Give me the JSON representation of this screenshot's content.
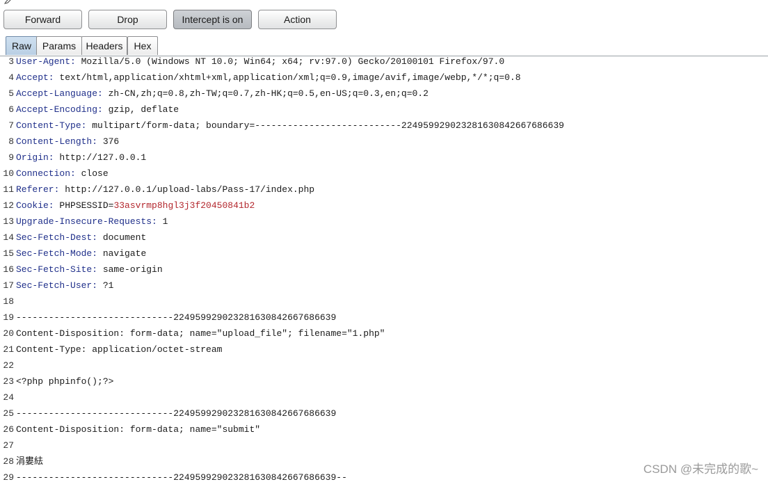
{
  "toolbar": {
    "forward": "Forward",
    "drop": "Drop",
    "intercept": "Intercept is on",
    "action": "Action"
  },
  "tabs": [
    "Raw",
    "Params",
    "Headers",
    "Hex"
  ],
  "active_tab": "Raw",
  "request_lines": [
    {
      "n": "3",
      "key": "User-Agent:",
      "val": " Mozilla/5.0 (Windows NT 10.0; Win64; x64; rv:97.0) Gecko/20100101 Firefox/97.0"
    },
    {
      "n": "4",
      "key": "Accept:",
      "val": " text/html,application/xhtml+xml,application/xml;q=0.9,image/avif,image/webp,*/*;q=0.8"
    },
    {
      "n": "5",
      "key": "Accept-Language:",
      "val": " zh-CN,zh;q=0.8,zh-TW;q=0.7,zh-HK;q=0.5,en-US;q=0.3,en;q=0.2"
    },
    {
      "n": "6",
      "key": "Accept-Encoding:",
      "val": " gzip, deflate"
    },
    {
      "n": "7",
      "key": "Content-Type:",
      "val": " multipart/form-data; boundary=---------------------------224959929023281630842667686639"
    },
    {
      "n": "8",
      "key": "Content-Length:",
      "val": " 376"
    },
    {
      "n": "9",
      "key": "Origin:",
      "val": " http://127.0.0.1"
    },
    {
      "n": "10",
      "key": "Connection:",
      "val": " close"
    },
    {
      "n": "11",
      "key": "Referer:",
      "val": " http://127.0.0.1/upload-labs/Pass-17/index.php"
    },
    {
      "n": "12",
      "key": "Cookie:",
      "val": " PHPSESSID=",
      "red": "33asvrmp8hgl3j3f20450841b2"
    },
    {
      "n": "13",
      "key": "Upgrade-Insecure-Requests:",
      "val": " 1"
    },
    {
      "n": "14",
      "key": "Sec-Fetch-Dest:",
      "val": " document"
    },
    {
      "n": "15",
      "key": "Sec-Fetch-Mode:",
      "val": " navigate"
    },
    {
      "n": "16",
      "key": "Sec-Fetch-Site:",
      "val": " same-origin"
    },
    {
      "n": "17",
      "key": "Sec-Fetch-User:",
      "val": " ?1"
    },
    {
      "n": "18",
      "key": "",
      "val": ""
    },
    {
      "n": "19",
      "key": "",
      "val": "-----------------------------224959929023281630842667686639"
    },
    {
      "n": "20",
      "key": "",
      "val": "Content-Disposition: form-data; name=\"upload_file\"; filename=\"1.php\""
    },
    {
      "n": "21",
      "key": "",
      "val": "Content-Type: application/octet-stream"
    },
    {
      "n": "22",
      "key": "",
      "val": ""
    },
    {
      "n": "23",
      "key": "",
      "val": "<?php phpinfo();?>"
    },
    {
      "n": "24",
      "key": "",
      "val": ""
    },
    {
      "n": "25",
      "key": "",
      "val": "-----------------------------224959929023281630842667686639"
    },
    {
      "n": "26",
      "key": "",
      "val": "Content-Disposition: form-data; name=\"submit\""
    },
    {
      "n": "27",
      "key": "",
      "val": ""
    },
    {
      "n": "28",
      "key": "",
      "val": "涓婁紶"
    },
    {
      "n": "29",
      "key": "",
      "val": "-----------------------------224959929023281630842667686639--"
    }
  ],
  "watermark": "CSDN @未完成的歌~"
}
